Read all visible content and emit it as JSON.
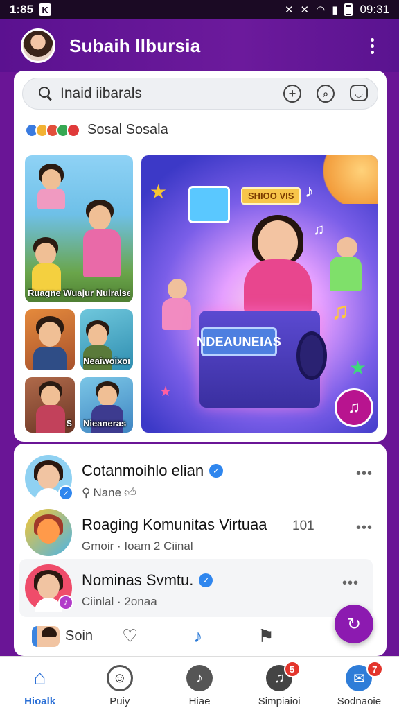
{
  "status_bar": {
    "time": "1:85",
    "notif_icon": "k-icon",
    "clock": "09:31"
  },
  "header": {
    "title": "Subaih llbursia"
  },
  "search": {
    "text": "Inaid iibarals"
  },
  "section": {
    "label": "Sosal Sosala",
    "dot_colors": [
      "#3a7be0",
      "#f2b233",
      "#e24f3b",
      "#36a853",
      "#e03a3a"
    ]
  },
  "thumbnails": [
    {
      "caption": "Ruagne Wuajur Nuiralse"
    },
    {
      "caption": ""
    },
    {
      "caption": "Neaiwoixont"
    },
    {
      "caption": "S"
    },
    {
      "caption": "Nieaneras"
    }
  ],
  "hero": {
    "plate_text": "NDEAUNEIAS",
    "tag_text": "SHIOO VIS"
  },
  "feed": [
    {
      "name": "Cotanmoihlo elian",
      "meta": "Nane",
      "verified": true,
      "count": ""
    },
    {
      "name": "Roaging Komunitas Virtuaa",
      "meta": "Gmoir  ·  Ioam  2 Ciinal",
      "verified": false,
      "count": "101"
    },
    {
      "name": "Nominas Svmtu.",
      "meta": "Ciinlal  ·  2onaa",
      "verified": true,
      "count": ""
    }
  ],
  "action_row": {
    "label": "Soin"
  },
  "bottom_nav": [
    {
      "label": "Hioalk",
      "active": true,
      "badge": ""
    },
    {
      "label": "Puiy",
      "active": false,
      "badge": ""
    },
    {
      "label": "Hiae",
      "active": false,
      "badge": ""
    },
    {
      "label": "Simpiaioi",
      "active": false,
      "badge": "5"
    },
    {
      "label": "Sodnaoie",
      "active": false,
      "badge": "7"
    }
  ],
  "colors": {
    "brand": "#6a1596",
    "accent": "#2f86ee",
    "badge": "#e3352c",
    "fab": "#8c1ab0"
  }
}
